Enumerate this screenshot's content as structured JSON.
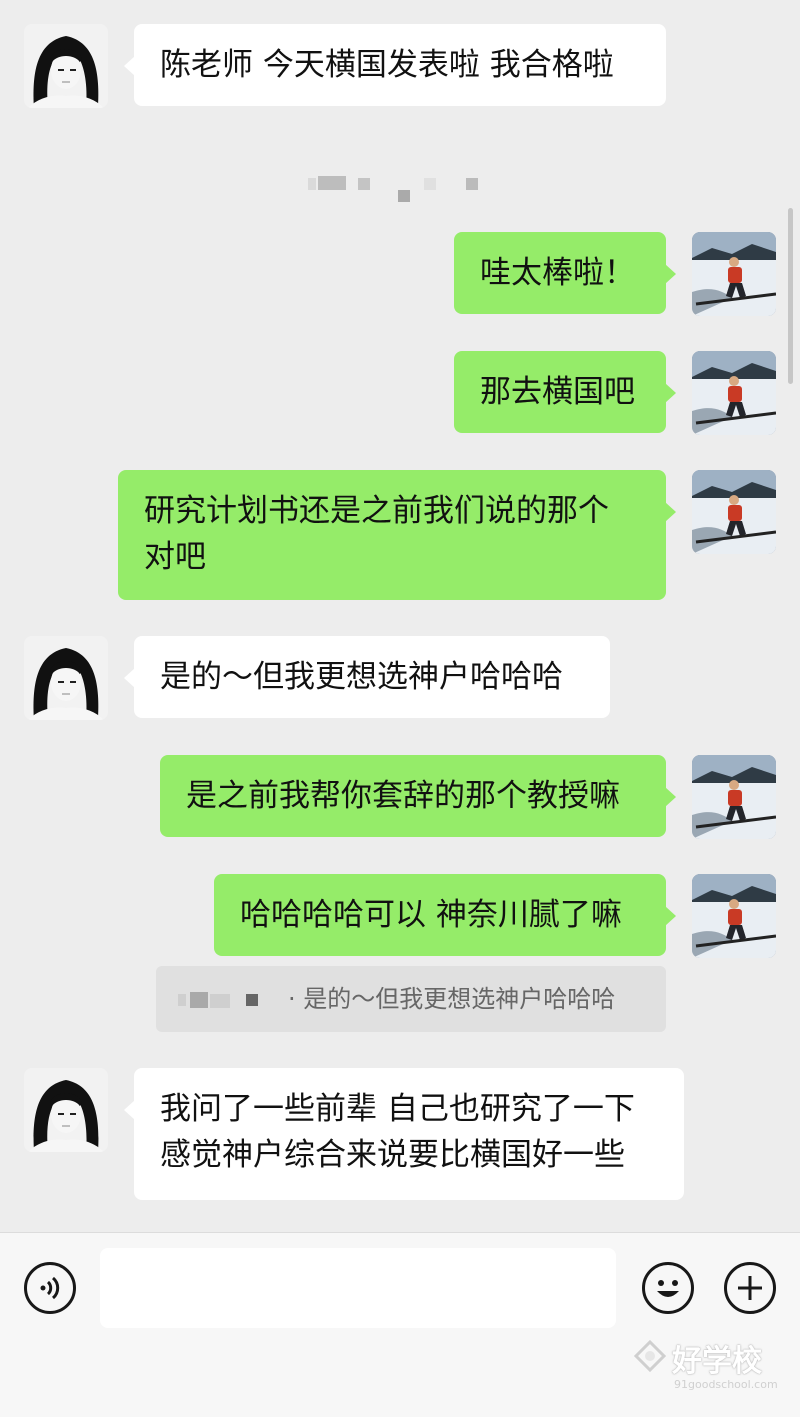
{
  "messages": [
    {
      "side": "in",
      "text": "陈老师 今天横国发表啦 我合格啦"
    },
    {
      "side": "out",
      "text": "哇太棒啦！"
    },
    {
      "side": "out",
      "text": "那去横国吧"
    },
    {
      "side": "out",
      "lines": [
        "研究计划书还是之前我们说的那个",
        "对吧"
      ]
    },
    {
      "side": "in",
      "text": "是的～但我更想选神户哈哈哈"
    },
    {
      "side": "out",
      "text": "是之前我帮你套辞的那个教授嘛"
    },
    {
      "side": "out",
      "text": "哈哈哈哈可以 神奈川腻了嘛"
    },
    {
      "side": "in",
      "lines": [
        "我问了一些前辈 自己也研究了一下",
        "感觉神户综合来说要比横国好一些"
      ]
    }
  ],
  "quote": {
    "text": "· 是的～但我更想选神户哈哈哈"
  },
  "input": {
    "placeholder": ""
  },
  "icons": {
    "voice": "voice-icon",
    "emoji": "emoji-icon",
    "add": "plus-icon"
  },
  "watermark": {
    "brand": "好学校",
    "url": "91goodschool.com"
  },
  "colors": {
    "background": "#ededed",
    "outgoing_bubble": "#95ec69",
    "incoming_bubble": "#ffffff"
  }
}
